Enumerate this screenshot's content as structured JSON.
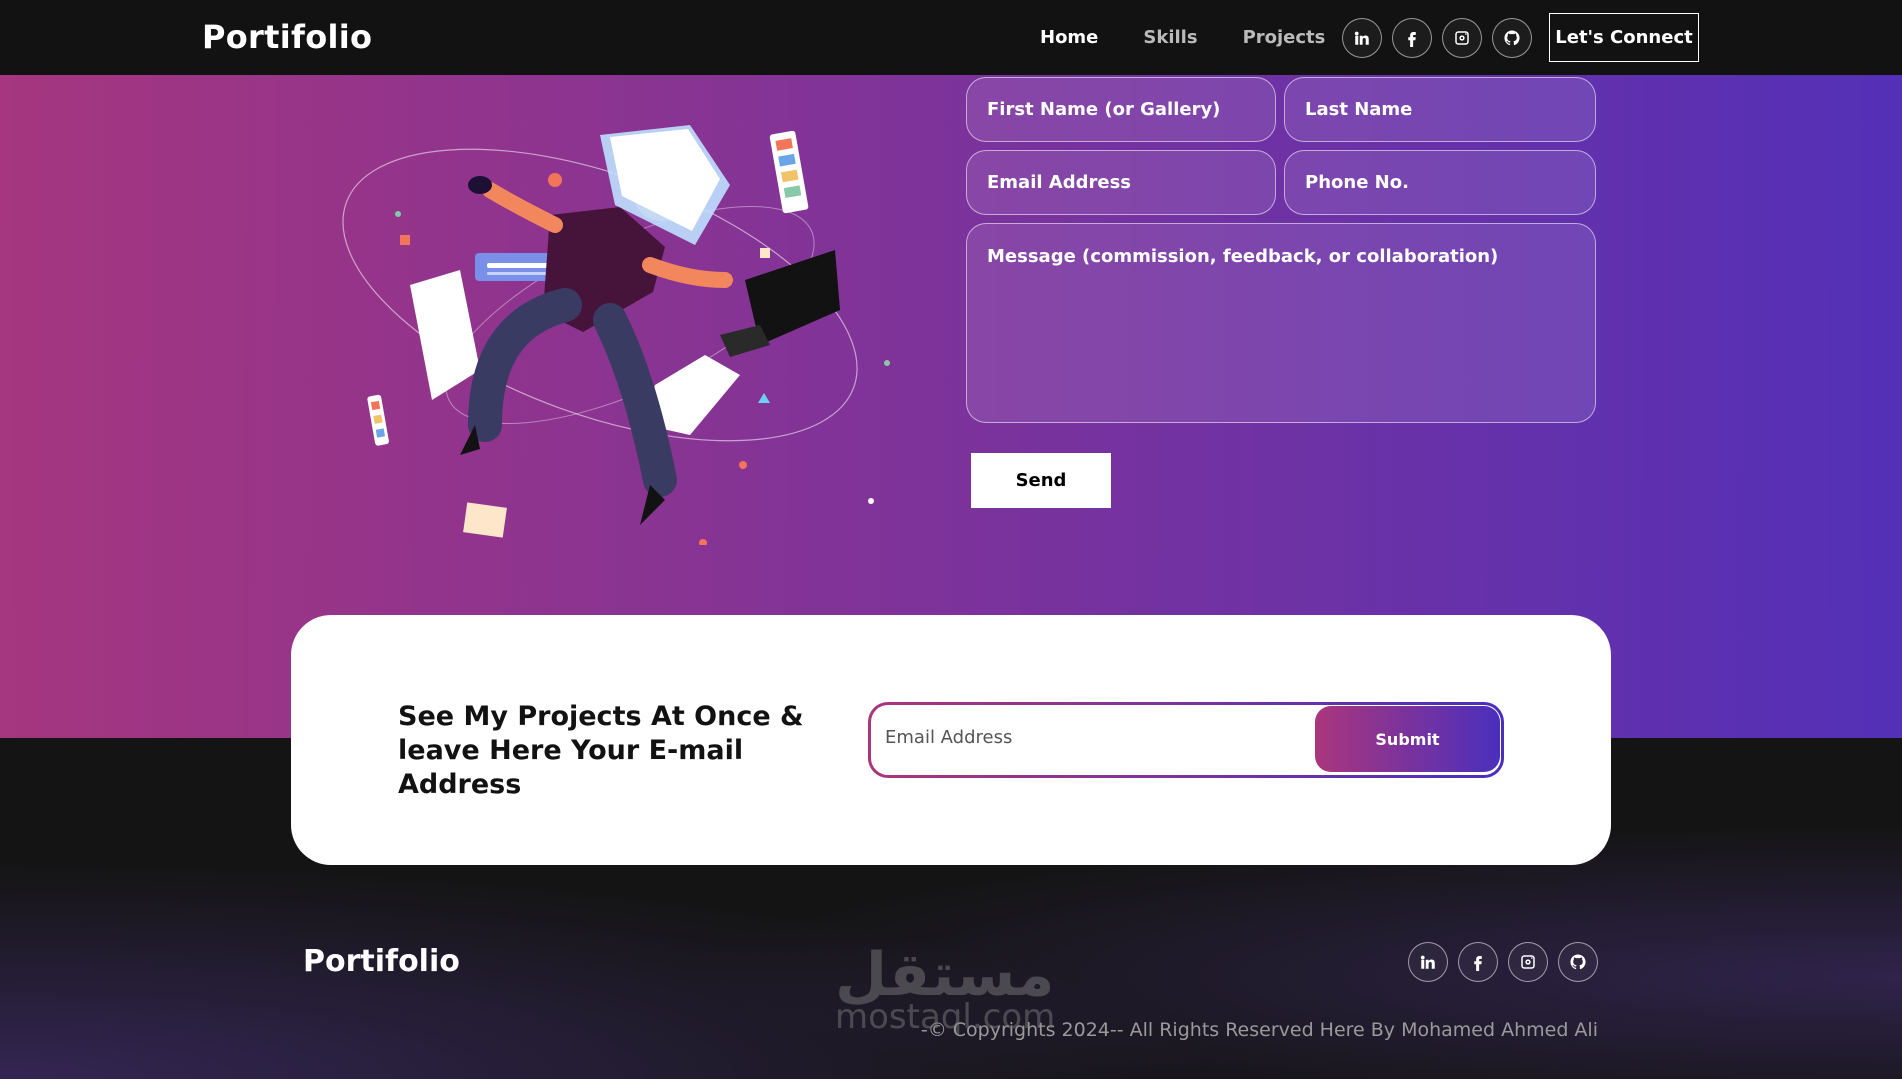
{
  "navbar": {
    "brand": "Portifolio",
    "links": [
      {
        "label": "Home"
      },
      {
        "label": "Skills"
      },
      {
        "label": "Projects"
      }
    ],
    "social": [
      "linkedin-icon",
      "facebook-icon",
      "instagram-icon",
      "github-icon"
    ],
    "connect_label": "Let's Connect"
  },
  "contact": {
    "first_name_placeholder": "First Name (or Gallery)",
    "last_name_placeholder": "Last Name",
    "email_placeholder": "Email Address",
    "phone_placeholder": "Phone No.",
    "message_placeholder": "Message (commission, feedback, or collaboration)",
    "send_label": "Send"
  },
  "newsletter": {
    "title": "See My Projects At Once & leave Here Your E-mail Address",
    "email_placeholder": "Email Address",
    "submit_label": "Submit"
  },
  "footer": {
    "brand": "Portifolio",
    "social": [
      "linkedin-icon",
      "facebook-icon",
      "instagram-icon",
      "github-icon"
    ],
    "copyright": "-© Copyrights 2024-- All Rights Reserved Here By Mohamed Ahmed Ali"
  },
  "watermark": {
    "arabic": "مستقل",
    "latin": "mostaql.com"
  },
  "colors": {
    "gradient_start": "#AA367C",
    "gradient_end": "#4A2FBD",
    "dark_bg": "#121212"
  }
}
